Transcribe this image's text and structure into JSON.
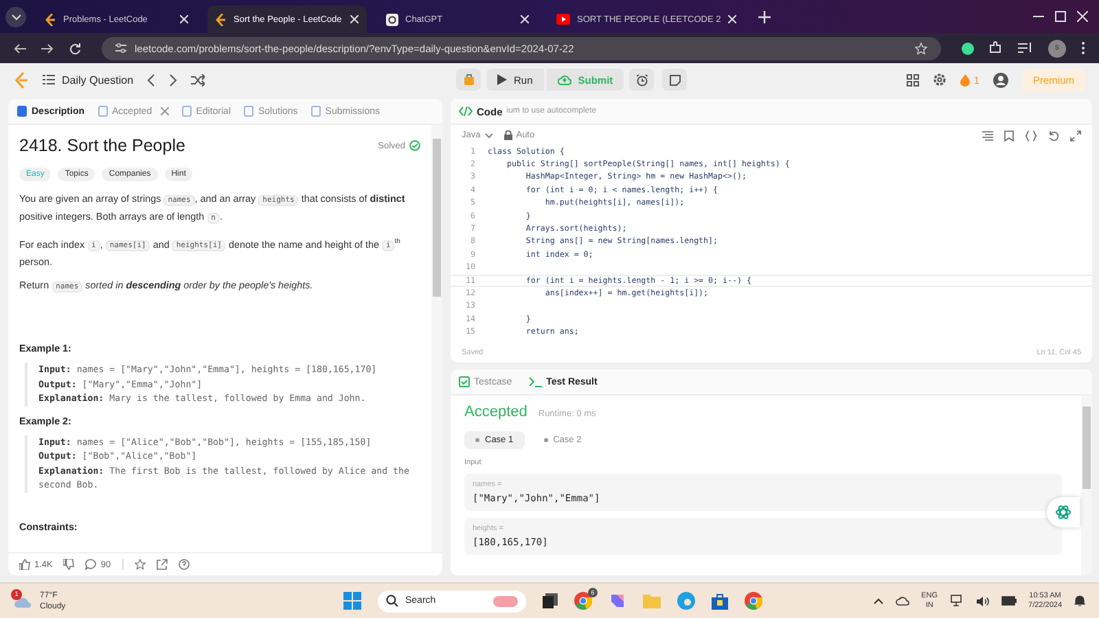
{
  "browser": {
    "tabs": [
      {
        "title": "Problems - LeetCode",
        "kind": "leetcode",
        "selected": false
      },
      {
        "title": "Sort the People - LeetCode",
        "kind": "leetcode",
        "selected": true
      },
      {
        "title": "ChatGPT",
        "kind": "chatgpt",
        "selected": false
      },
      {
        "title": "SORT THE PEOPLE (LEETCODE 2",
        "kind": "youtube",
        "selected": false
      }
    ],
    "url": "leetcode.com/problems/sort-the-people/description/?envType=daily-question&envId=2024-07-22",
    "profile": "s"
  },
  "topbar": {
    "daily": "Daily Question",
    "run": "Run",
    "submit": "Submit",
    "streak": "1",
    "premium": "Premium"
  },
  "problem": {
    "tabs": [
      {
        "label": "Description",
        "selected": true,
        "closable": false
      },
      {
        "label": "Accepted",
        "selected": false,
        "closable": true
      },
      {
        "label": "Editorial",
        "selected": false,
        "closable": false
      },
      {
        "label": "Solutions",
        "selected": false,
        "closable": false
      },
      {
        "label": "Submissions",
        "selected": false,
        "closable": false
      }
    ],
    "title": "2418. Sort the People",
    "status": "Solved",
    "difficulty": "Easy",
    "tags": [
      "Topics",
      "Companies",
      "Hint"
    ],
    "paragraphs": [
      [
        {
          "kind": "text",
          "text": "You are given an array of strings "
        },
        {
          "kind": "code",
          "text": "names"
        },
        {
          "kind": "text",
          "text": ", and an array "
        },
        {
          "kind": "code",
          "text": "heights"
        },
        {
          "kind": "text",
          "text": " that consists of "
        },
        {
          "kind": "bold",
          "text": "distinct"
        },
        {
          "kind": "text",
          "text": " positive integers. Both arrays are of length "
        },
        {
          "kind": "code",
          "text": "n"
        },
        {
          "kind": "text",
          "text": "."
        }
      ],
      [
        {
          "kind": "text",
          "text": "For each index "
        },
        {
          "kind": "code",
          "text": "i"
        },
        {
          "kind": "text",
          "text": ", "
        },
        {
          "kind": "code",
          "text": "names[i]"
        },
        {
          "kind": "text",
          "text": " and "
        },
        {
          "kind": "code",
          "text": "heights[i]"
        },
        {
          "kind": "text",
          "text": " denote the name and height of the "
        },
        {
          "kind": "code",
          "text": "i"
        },
        {
          "kind": "sup",
          "text": "th"
        },
        {
          "kind": "text",
          "text": " person."
        }
      ],
      [
        {
          "kind": "text",
          "text": "Return "
        },
        {
          "kind": "code",
          "text": "names"
        },
        {
          "kind": "italic",
          "text": " sorted in "
        },
        {
          "kind": "bolditalic",
          "text": "descending"
        },
        {
          "kind": "italic",
          "text": " order by the people's heights."
        }
      ]
    ],
    "examples": [
      {
        "title": "Example 1:",
        "lines": [
          {
            "label": "Input:",
            "value": "names = [\"Mary\",\"John\",\"Emma\"], heights = [180,165,170]"
          },
          {
            "label": "Output:",
            "value": "[\"Mary\",\"Emma\",\"John\"]"
          },
          {
            "label": "Explanation:",
            "value": "Mary is the tallest, followed by Emma and John."
          }
        ]
      },
      {
        "title": "Example 2:",
        "lines": [
          {
            "label": "Input:",
            "value": "names = [\"Alice\",\"Bob\",\"Bob\"], heights = [155,185,150]"
          },
          {
            "label": "Output:",
            "value": "[\"Bob\",\"Alice\",\"Bob\"]"
          },
          {
            "label": "Explanation:",
            "value": "The first Bob is the tallest, followed by Alice and the second Bob."
          }
        ]
      }
    ],
    "constraints": "Constraints:",
    "likes": "1.4K",
    "comments": "90"
  },
  "editor": {
    "title": "Code",
    "hint": "ium to use autocomplete",
    "language": "Java",
    "mode": "Auto",
    "lines": [
      {
        "number": "1",
        "text": "class Solution {",
        "current": false
      },
      {
        "number": "2",
        "text": "    public String[] sortPeople(String[] names, int[] heights) {",
        "current": false
      },
      {
        "number": "3",
        "text": "        HashMap<Integer, String> hm = new HashMap<>();",
        "current": false
      },
      {
        "number": "4",
        "text": "        for (int i = 0; i < names.length; i++) {",
        "current": false
      },
      {
        "number": "5",
        "text": "            hm.put(heights[i], names[i]);",
        "current": false
      },
      {
        "number": "6",
        "text": "        }",
        "current": false
      },
      {
        "number": "7",
        "text": "        Arrays.sort(heights);",
        "current": false
      },
      {
        "number": "8",
        "text": "        String ans[] = new String[names.length];",
        "current": false
      },
      {
        "number": "9",
        "text": "        int index = 0;",
        "current": false
      },
      {
        "number": "10",
        "current": false
      },
      {
        "number": "11",
        "text": "        for (int i = heights.length - 1; i >= 0; i--) {",
        "current": true
      },
      {
        "number": "12",
        "text": "            ans[index++] = hm.get(heights[i]);",
        "current": false
      },
      {
        "number": "13",
        "current": false
      },
      {
        "number": "14",
        "text": "        }",
        "current": false
      },
      {
        "number": "15",
        "text": "        return ans;",
        "current": false
      }
    ],
    "saved": "Saved",
    "position": "Ln 11, Col 45"
  },
  "result": {
    "tabs": [
      {
        "label": "Testcase",
        "selected": false
      },
      {
        "label": "Test Result",
        "selected": true
      }
    ],
    "verdict": "Accepted",
    "runtime": "Runtime: 0 ms",
    "cases": [
      {
        "label": "Case 1",
        "selected": true
      },
      {
        "label": "Case 2",
        "selected": false
      }
    ],
    "input_label": "Input",
    "inputs": [
      {
        "name": "names =",
        "value": "[\"Mary\",\"John\",\"Emma\"]"
      },
      {
        "name": "heights =",
        "value": "[180,165,170]"
      }
    ]
  },
  "taskbar": {
    "weather_badge": "1",
    "temperature": "77°F",
    "condition": "Cloudy",
    "search": "Search",
    "chrome_badge": "6",
    "language": "ENG",
    "region": "IN",
    "time": "10:53 AM",
    "date": "7/22/2024"
  }
}
